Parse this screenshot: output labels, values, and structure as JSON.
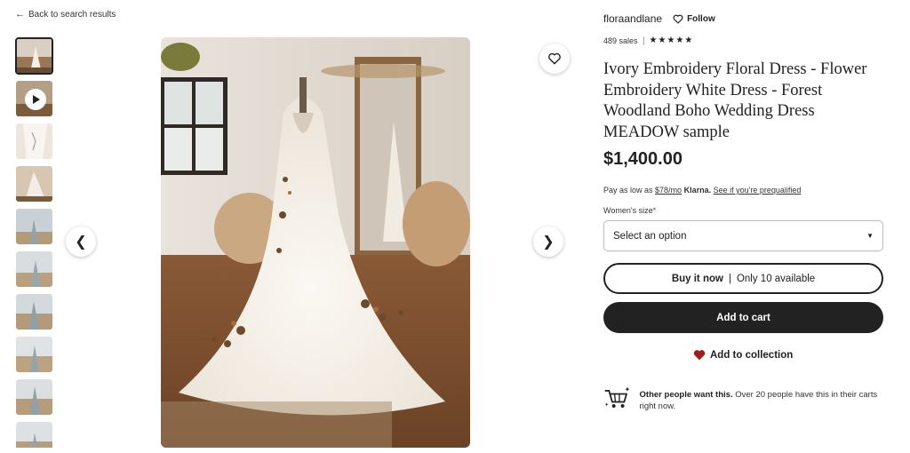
{
  "nav": {
    "back_label": "Back to search results"
  },
  "shop": {
    "name": "floraandlane",
    "follow_label": "Follow",
    "sales": "489 sales",
    "stars": "★★★★★"
  },
  "listing": {
    "title": "Ivory Embroidery Floral Dress - Flower Embroidery White Dress - Forest Woodland Boho Wedding Dress MEADOW sample",
    "price": "$1,400.00"
  },
  "klarna": {
    "prefix": "Pay as low as",
    "amount": "$78/mo",
    "brand": "Klarna.",
    "link": "See if you're prequalified"
  },
  "size": {
    "label": "Women's size",
    "required_mark": "*",
    "placeholder": "Select an option"
  },
  "buy": {
    "label": "Buy it now",
    "separator": "|",
    "availability": "Only 10 available"
  },
  "cart": {
    "label": "Add to cart"
  },
  "collection": {
    "label": "Add to collection"
  },
  "demand": {
    "bold": "Other people want this.",
    "rest": "Over 20 people have this in their carts right now."
  },
  "gallery": {
    "thumbnail_count": 10,
    "selected_index": 0,
    "video_thumbnail_index": 1
  },
  "colors": {
    "primary": "#222222",
    "required": "#b3261e",
    "heart": "#a61a1a"
  },
  "icons": [
    "back-arrow-icon",
    "heart-outline-icon",
    "chevron-left-icon",
    "chevron-right-icon",
    "heart-filled-icon",
    "cart-sparkle-icon",
    "play-icon"
  ]
}
